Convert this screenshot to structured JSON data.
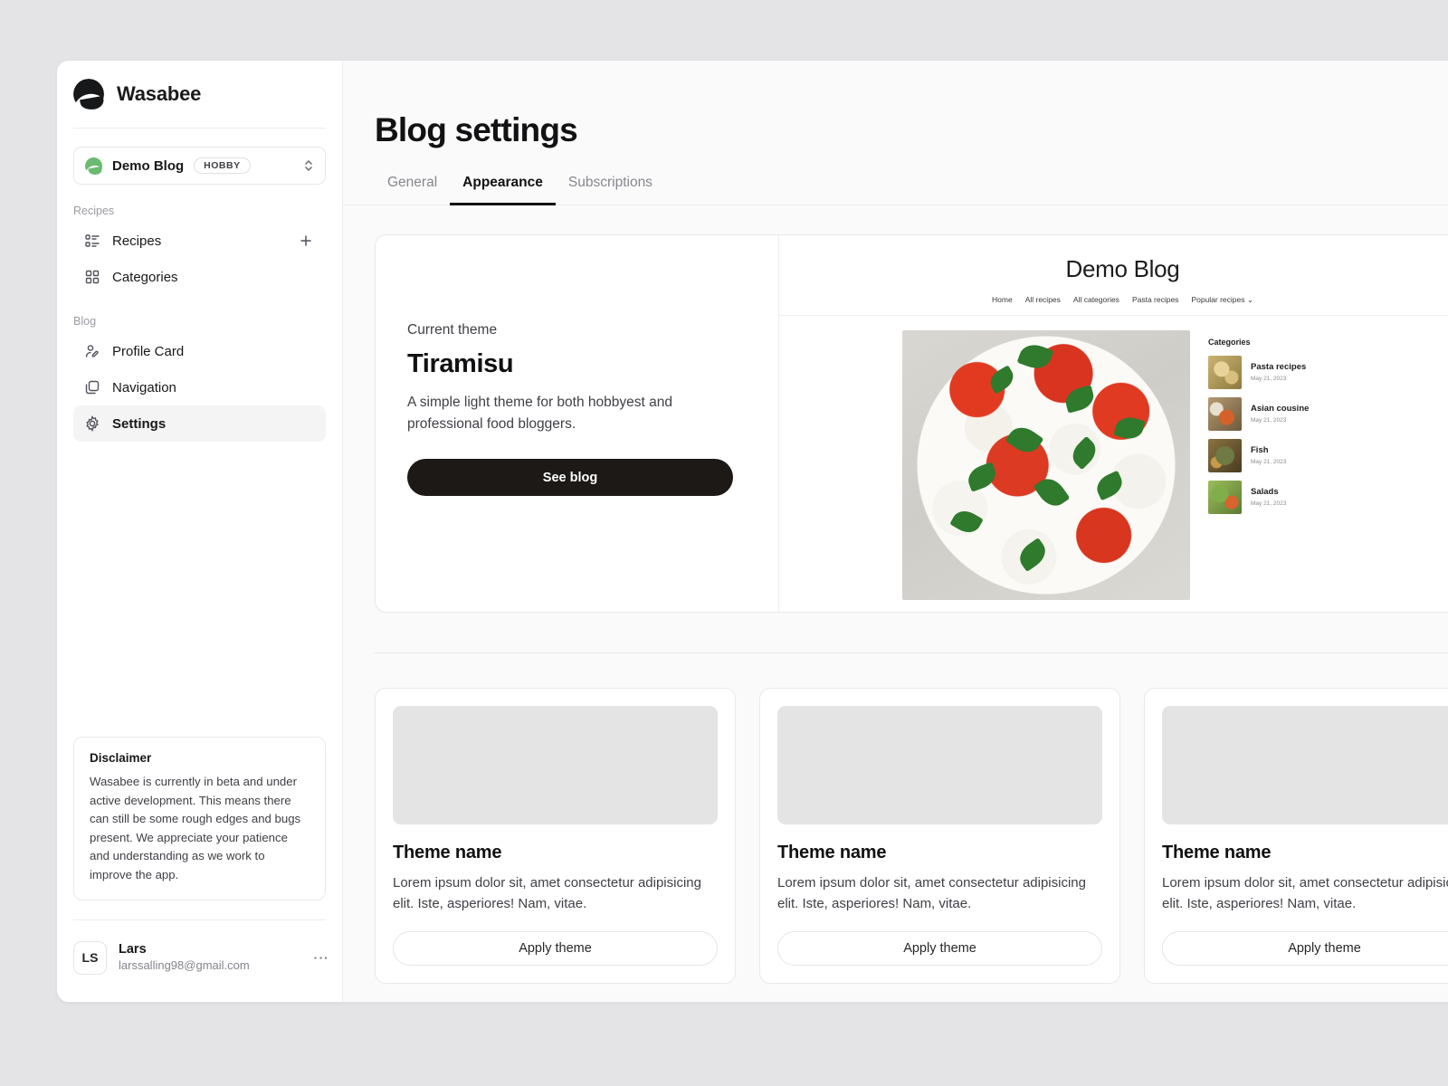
{
  "sidebar": {
    "brand": {
      "name": "Wasabee",
      "logo_icon": "wasabee-logo-icon"
    },
    "blog_selector": {
      "icon": "leaf-icon",
      "name": "Demo Blog",
      "badge": "HOBBY",
      "chevron_icon": "chevron-up-down-icon"
    },
    "groups": [
      {
        "label": "Recipes",
        "items": [
          {
            "label": "Recipes",
            "icon": "list-icon",
            "active": false,
            "action_icon": "plus-icon"
          },
          {
            "label": "Categories",
            "icon": "grid-icon",
            "active": false
          }
        ]
      },
      {
        "label": "Blog",
        "items": [
          {
            "label": "Profile Card",
            "icon": "user-edit-icon",
            "active": false
          },
          {
            "label": "Navigation",
            "icon": "copy-icon",
            "active": false
          },
          {
            "label": "Settings",
            "icon": "gear-icon",
            "active": true
          }
        ]
      }
    ],
    "disclaimer": {
      "title": "Disclaimer",
      "text": "Wasabee is currently in beta and under active development. This means there can still be some rough edges and bugs present. We appreciate your patience and understanding as we work to improve the app."
    },
    "user": {
      "initials": "LS",
      "name": "Lars",
      "email": "larssalling98@gmail.com",
      "menu_icon": "kebab-menu-icon"
    }
  },
  "main": {
    "page_title": "Blog settings",
    "tabs": [
      {
        "label": "General",
        "active": false
      },
      {
        "label": "Appearance",
        "active": true
      },
      {
        "label": "Subscriptions",
        "active": false
      }
    ],
    "current_theme": {
      "eyebrow": "Current theme",
      "name": "Tiramisu",
      "description": "A simple light theme for both hobbyest and professional food bloggers.",
      "cta": "See blog"
    },
    "blog_preview": {
      "title": "Demo Blog",
      "nav": [
        "Home",
        "All recipes",
        "All categories",
        "Pasta recipes",
        "Popular recipes"
      ],
      "nav_dropdown_icon": "chevron-down-icon",
      "hero_image": "caprese-salad-photo",
      "sidebar_title": "Categories",
      "categories": [
        {
          "name": "Pasta recipes",
          "date": "May 21, 2023"
        },
        {
          "name": "Asian cousine",
          "date": "May 21, 2023"
        },
        {
          "name": "Fish",
          "date": "May 21, 2023"
        },
        {
          "name": "Salads",
          "date": "May 21, 2023"
        }
      ]
    },
    "theme_cards": [
      {
        "name": "Theme name",
        "description": "Lorem ipsum dolor sit, amet consectetur adipisicing elit. Iste, asperiores! Nam, vitae.",
        "cta": "Apply theme"
      },
      {
        "name": "Theme name",
        "description": "Lorem ipsum dolor sit, amet consectetur adipisicing elit. Iste, asperiores! Nam, vitae.",
        "cta": "Apply theme"
      },
      {
        "name": "Theme name",
        "description": "Lorem ipsum dolor sit, amet consectetur adipisicing elit. Iste, asperiores! Nam, vitae.",
        "cta": "Apply theme"
      }
    ]
  },
  "colors": {
    "accent_dark": "#1c1917",
    "brand_green": "#6aba6f",
    "page_bg": "#e4e4e7",
    "content_bg": "#fafafa"
  }
}
